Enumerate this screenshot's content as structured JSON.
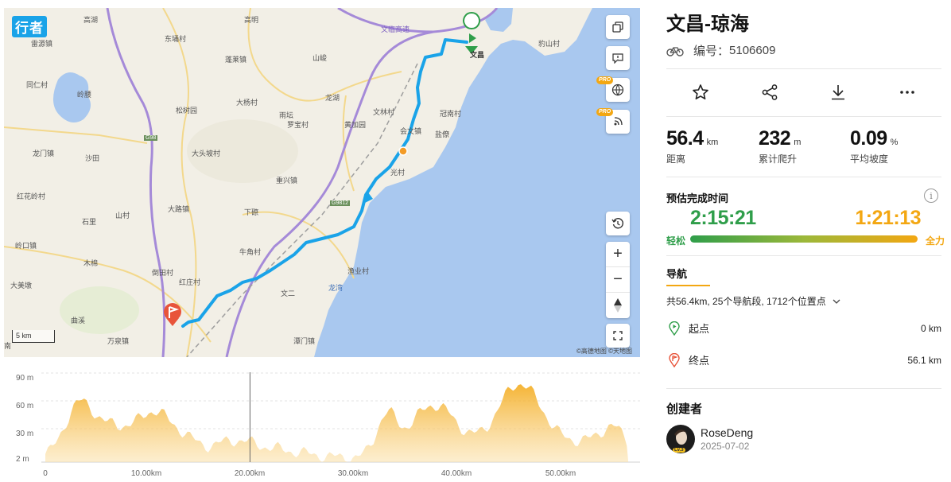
{
  "map": {
    "logo_text": "行者",
    "scale_label": "5 km",
    "copyright": "©高德地图  ©天地图",
    "pro_badge": "PRO",
    "labels": {
      "gaohu": "高湖",
      "gaoming": "高明",
      "leiyuan": "雷源镇",
      "dongyong": "东埇村",
      "penglai": "蓬莱镇",
      "shanjun": "山峻",
      "wenchang_hwy": "文临高速",
      "tongren": "同仁村",
      "lingding": "岭腰",
      "songshu": "松树园",
      "dayang": "大杨村",
      "longhu": "龙湖",
      "wenlin": "文林村",
      "guannan": "冠南村",
      "baoshan": "豹山村",
      "shayi": "沙田",
      "longmen": "龙门镇",
      "datou": "大头坡村",
      "yutan": "雨坛",
      "luobao": "罗宝村",
      "huangjia": "黄加园",
      "huiwen": "会文镇",
      "penglai2": "盐僚",
      "g98": "G98",
      "hongqi": "红花岭村",
      "chongxing": "重兴镇",
      "guangbei": "光村",
      "shicun": "石里",
      "shancun": "山村",
      "dalu": "大路镇",
      "xiapo": "下磜",
      "g9812": "G9812",
      "lingkou": "岭口镇",
      "niujiao": "牛角村",
      "mumian": "木棉",
      "tianmen": "倒田村",
      "hongzhuang": "红庄村",
      "yuye": "渔业村",
      "longwan": "龙湾",
      "damei": "大美墩",
      "wener": "文二",
      "qudian": "曲溪",
      "wanquan": "万泉镇",
      "tanmen": "潭门镇",
      "nan": "南",
      "wenchang_start": "文昌"
    }
  },
  "elevation": {
    "y_ticks": [
      "90 m",
      "60 m",
      "30 m",
      "2 m"
    ],
    "x_ticks": [
      "0",
      "10.00km",
      "20.00km",
      "30.00km",
      "40.00km",
      "50.00km"
    ],
    "cursor_km": 19.8,
    "ymin": 2,
    "ymax": 90
  },
  "route": {
    "title": "文昌-琼海",
    "id_label": "编号：",
    "id_value": "5106609",
    "stats": [
      {
        "value": "56.4",
        "unit": "km",
        "label": "距离"
      },
      {
        "value": "232",
        "unit": "m",
        "label": "累计爬升"
      },
      {
        "value": "0.09",
        "unit": "%",
        "label": "平均坡度"
      }
    ],
    "eta": {
      "title": "预估完成时间",
      "easy_time": "2:15:21",
      "fast_time": "1:21:13",
      "easy_label": "轻松",
      "fast_label": "全力"
    },
    "nav": {
      "title": "导航",
      "summary": "共56.4km, 25个导航段, 1712个位置点",
      "start_label": "起点",
      "start_value": "0 km",
      "end_label": "终点",
      "end_value": "56.1 km"
    },
    "creator": {
      "title": "创建者",
      "name": "RoseDeng",
      "date": "2025-07-02",
      "level": "Lv.3"
    }
  },
  "colors": {
    "route": "#1aa3e8",
    "easy": "#2f9e4a",
    "fast": "#f3a712",
    "sea": "#a9c8ef"
  }
}
